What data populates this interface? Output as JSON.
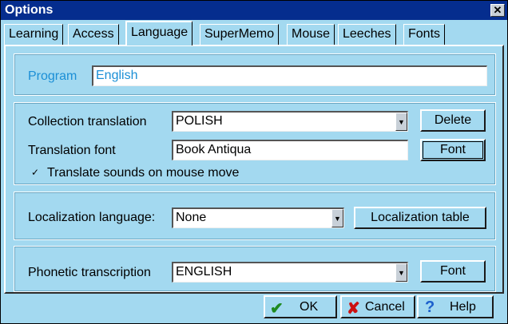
{
  "window": {
    "title": "Options",
    "close_label": "✕"
  },
  "tabs": [
    {
      "label": "Learning",
      "active": false
    },
    {
      "label": "Access",
      "active": false
    },
    {
      "label": "Language",
      "active": true
    },
    {
      "label": "SuperMemo",
      "active": false
    },
    {
      "label": "Mouse",
      "active": false
    },
    {
      "label": "Leeches",
      "active": false
    },
    {
      "label": "Fonts",
      "active": false
    }
  ],
  "program": {
    "label": "Program",
    "value": "English"
  },
  "collection_translation": {
    "label": "Collection translation",
    "value": "POLISH",
    "button": "Delete"
  },
  "translation_font": {
    "label": "Translation font",
    "value": "Book Antiqua",
    "button": "Font"
  },
  "translate_sounds": {
    "label": "Translate sounds on mouse move",
    "checked": "✓"
  },
  "localization": {
    "label": "Localization language:",
    "value": "None",
    "button": "Localization table"
  },
  "phonetic": {
    "label": "Phonetic transcription",
    "value": "ENGLISH",
    "button": "Font"
  },
  "dialog_buttons": {
    "ok": "OK",
    "cancel": "Cancel",
    "help": "Help"
  },
  "icons": {
    "ok": "check-icon",
    "cancel": "x-icon",
    "help": "question-icon",
    "dropdown": "chevron-down-icon"
  },
  "colors": {
    "titlebar": "#052d8e",
    "background": "#a3d9f0",
    "program_text": "#1b8fd6",
    "ok_icon": "#1f8a1f",
    "cancel_icon": "#cc1111",
    "help_icon": "#1c5fcc"
  }
}
